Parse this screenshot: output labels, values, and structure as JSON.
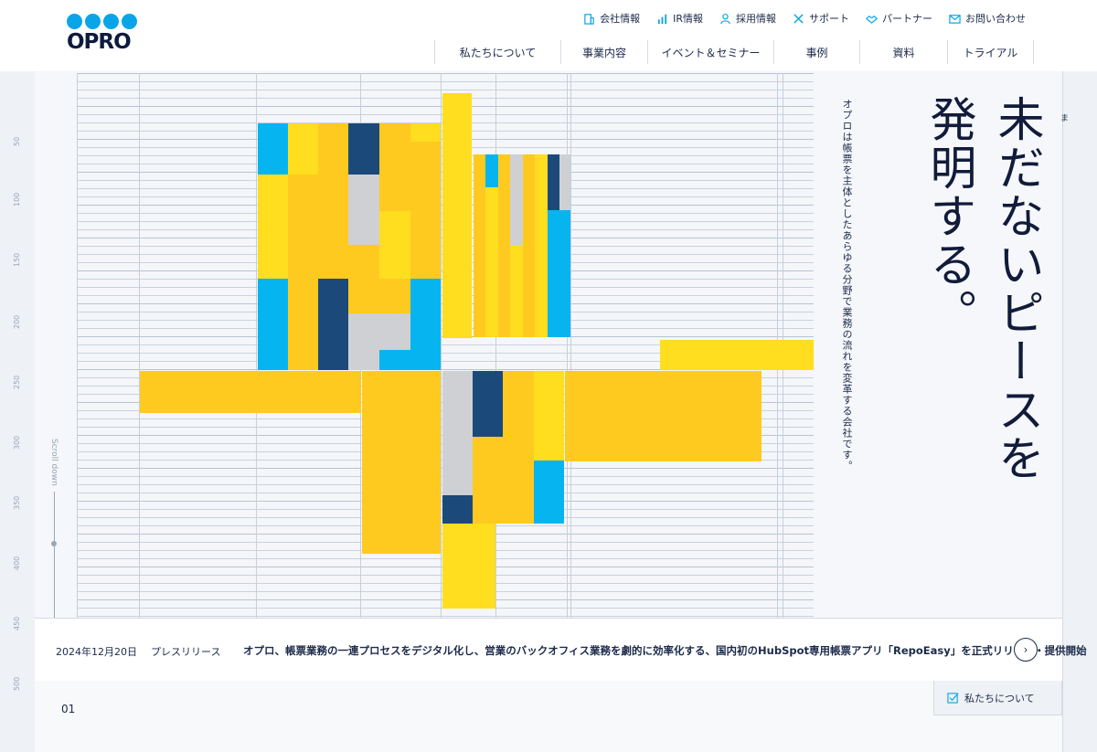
{
  "brand": {
    "logo_text": "OPRO",
    "accent": "#0aa5e8"
  },
  "utility_nav": [
    {
      "label": "会社情報",
      "icon": "building-icon"
    },
    {
      "label": "IR情報",
      "icon": "bar-chart-icon"
    },
    {
      "label": "採用情報",
      "icon": "person-icon"
    },
    {
      "label": "サポート",
      "icon": "tools-icon"
    },
    {
      "label": "パートナー",
      "icon": "handshake-icon"
    },
    {
      "label": "お問い合わせ",
      "icon": "mail-icon"
    }
  ],
  "main_nav": [
    "私たちについて",
    "事業内容",
    "イベント＆セミナー",
    "事例",
    "資料",
    "トライアル"
  ],
  "hero": {
    "headline": "未だないピースを発明する。",
    "ruby": "ま",
    "subtext": "オプロは帳票を主体としたあらゆる分野で業務の流れを変革する会社です。",
    "scroll_label": "Scroll down"
  },
  "ruler_ticks": [
    "50",
    "100",
    "150",
    "200",
    "250",
    "300",
    "350",
    "400",
    "450",
    "500"
  ],
  "news": {
    "date": "2024年12月20日",
    "category": "プレスリリース",
    "title": "オプロ、帳票業務の一連プロセスをデジタル化し、営業のバックオフィス業務を劇的に効率化する、国内初のHubSpot専用帳票アプリ「RepoEasy」を正式リリース・提供開始"
  },
  "section": {
    "number": "01",
    "tag_label": "私たちについて"
  },
  "palette": {
    "yellow": "#ffdd1f",
    "amber": "#ffca1f",
    "blue": "#06b4f0",
    "navy": "#1b4a7a",
    "gray": "#cfd0d3"
  }
}
